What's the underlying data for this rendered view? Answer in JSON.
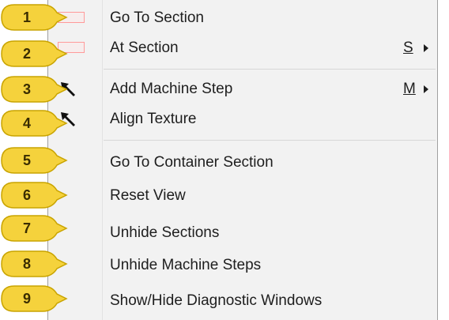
{
  "menu": {
    "items": [
      {
        "callout": "1",
        "label": "Go To Section",
        "icon": "swatch-icon",
        "shortcut": "",
        "submenu": false
      },
      {
        "callout": "2",
        "label": "At Section",
        "icon": "swatch-icon",
        "shortcut": "S",
        "submenu": true
      },
      {
        "callout": "3",
        "label": "Add Machine Step",
        "icon": "cursor-arrow-icon",
        "shortcut": "M",
        "submenu": true
      },
      {
        "callout": "4",
        "label": "Align Texture",
        "icon": "cursor-arrow-icon",
        "shortcut": "",
        "submenu": false
      },
      {
        "callout": "5",
        "label": "Go To Container Section",
        "icon": "",
        "shortcut": "",
        "submenu": false
      },
      {
        "callout": "6",
        "label": "Reset View",
        "icon": "",
        "shortcut": "",
        "submenu": false
      },
      {
        "callout": "7",
        "label": "Unhide Sections",
        "icon": "",
        "shortcut": "",
        "submenu": false
      },
      {
        "callout": "8",
        "label": "Unhide Machine Steps",
        "icon": "",
        "shortcut": "",
        "submenu": false
      },
      {
        "callout": "9",
        "label": "Show/Hide Diagnostic Windows",
        "icon": "",
        "shortcut": "",
        "submenu": false
      }
    ]
  },
  "colors": {
    "callout_fill": "#f5d23c",
    "callout_stroke": "#c9a400",
    "menu_background": "#f2f2f2",
    "swatch_border": "#ff9a9a"
  }
}
